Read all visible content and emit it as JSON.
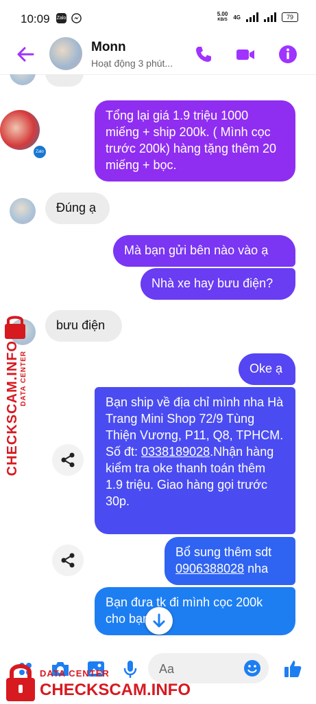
{
  "statusbar": {
    "time": "10:09",
    "app1": "Zalo",
    "net_speed_value": "5.00",
    "net_speed_unit": "KB/S",
    "net_type": "4G",
    "battery": "79"
  },
  "header": {
    "name": "Monn",
    "status": "Hoạt động 3 phút..."
  },
  "messages": [
    {
      "text": "Tổng lại giá 1.9 triệu 1000 miếng + ship 200k. ( Mình cọc trước 200k) hàng tặng thêm 20 miếng + bọc."
    },
    {
      "text": "Đúng ạ"
    },
    {
      "text": "Mà bạn gửi bên nào vào ạ"
    },
    {
      "text": "Nhà xe hay bưu điện?"
    },
    {
      "text": "bưu điện"
    },
    {
      "text": "Oke ạ"
    },
    {
      "text_before": "Bạn ship về địa chỉ mình nha Hà Trang Mini Shop 72/9 Tùng Thiện Vương, P11, Q8, TPHCM. Số đt: ",
      "phone": "0338189028",
      "text_after": ".Nhận hàng kiểm tra oke thanh toán thêm 1.9 triệu. Giao hàng gọi trước 30p."
    },
    {
      "text_before": "Bổ sung thêm sdt ",
      "phone": "0906388028",
      "text_after": " nha"
    },
    {
      "text": "Bạn đưa tk đi mình cọc 200k cho bạn"
    }
  ],
  "composer": {
    "placeholder": "Aa"
  },
  "watermark": {
    "title": "CHECKSCAM.INFO",
    "subtitle": "DATA CENTER"
  },
  "colors": {
    "accent": "#a033ff",
    "bubble_purple": "#8f2ef0",
    "bubble_blue": "#3c55f0",
    "bubble_lightblue": "#1d7ef2",
    "watermark": "#d71920"
  }
}
